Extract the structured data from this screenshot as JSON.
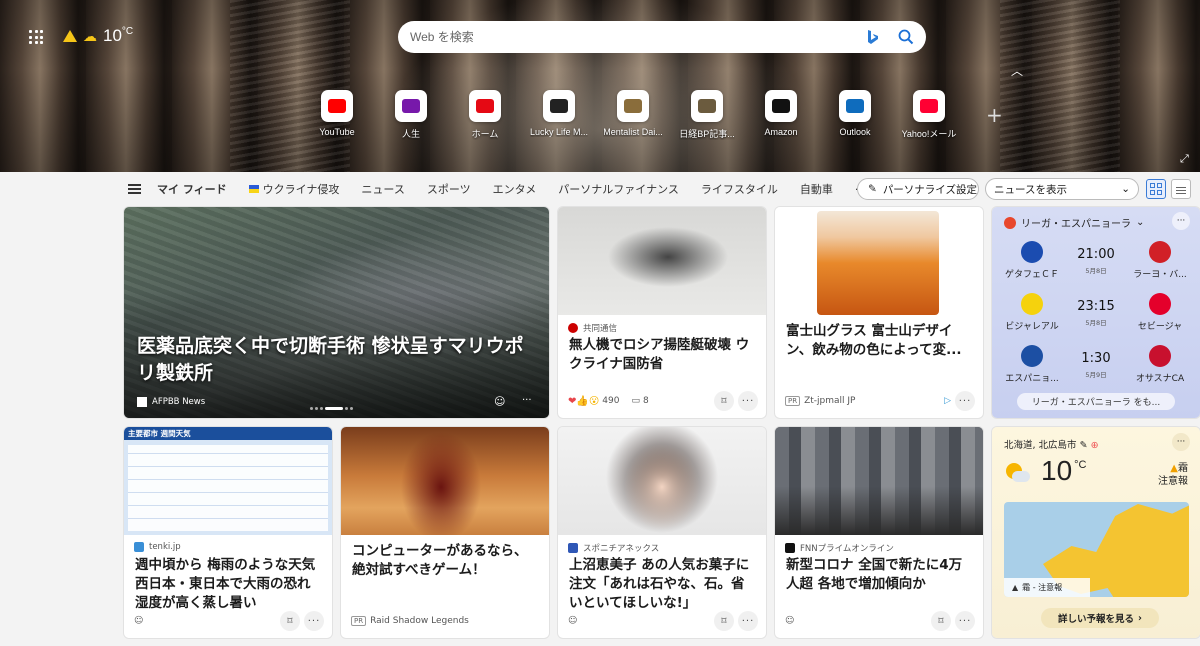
{
  "top": {
    "temperature": "10",
    "temp_unit": "°C"
  },
  "search": {
    "placeholder": "Web を検索"
  },
  "quick_links": [
    {
      "label": "YouTube",
      "icon": "youtube-icon",
      "color": "#ff0000"
    },
    {
      "label": "人生",
      "icon": "onenote-icon",
      "color": "#7719aa"
    },
    {
      "label": "ホーム",
      "icon": "netflix-icon",
      "color": "#e50914"
    },
    {
      "label": "Lucky Life M...",
      "icon": "lucky-life-icon",
      "color": "#222222"
    },
    {
      "label": "Mentalist Dai...",
      "icon": "mentalist-icon",
      "color": "#8a6d3b"
    },
    {
      "label": "日経BP記事...",
      "icon": "nikkei-icon",
      "color": "#6b5b3e"
    },
    {
      "label": "Amazon",
      "icon": "amazon-icon",
      "color": "#111111"
    },
    {
      "label": "Outlook",
      "icon": "outlook-icon",
      "color": "#0f6cbd"
    },
    {
      "label": "Yahoo!メール",
      "icon": "yahoo-mail-icon",
      "color": "#ff0033"
    }
  ],
  "nav": {
    "items": [
      "マイ フィード",
      "ウクライナ侵攻",
      "ニュース",
      "スポーツ",
      "エンタメ",
      "パーソナルファイナンス",
      "ライフスタイル",
      "自動車"
    ],
    "more": "···",
    "personalize": "パーソナライズ設定",
    "view_select": "ニュースを表示"
  },
  "cards": {
    "hero": {
      "title": "医薬品底突く中で切断手術 惨状呈すマリウポリ製鉄所",
      "source": "AFPBB News",
      "more": "···"
    },
    "c2": {
      "source": "共同通信",
      "title": "無人機でロシア揚陸艇破壊 ウクライナ国防省",
      "reactions": "490",
      "comments": "8",
      "more": "···"
    },
    "c3": {
      "pr": "PR",
      "source": "Zt-jpmall JP",
      "title": "富士山グラス 富士山デザイン、飲み物の色によって変...",
      "more": "···"
    },
    "c5": {
      "source": "tenki.jp",
      "title": "週中頃から 梅雨のような天気 西日本・東日本で大雨の恐れ 湿度が高く蒸し暑い",
      "map_title": "主要都市  週間天気",
      "more": "···"
    },
    "c6": {
      "pr": "PR",
      "source": "Raid Shadow Legends",
      "title": "コンピューターがあるなら、絶対試すべきゲーム！"
    },
    "c7": {
      "source": "スポニチアネックス",
      "title": "上沼恵美子 あの人気お菓子に注文「あれは石やな、石。省いといてほしいな!」",
      "more": "···"
    },
    "c8": {
      "source": "FNNプライムオンライン",
      "title": "新型コロナ 全国で新たに4万人超 各地で増加傾向か",
      "more": "···"
    }
  },
  "sports": {
    "league": "リーガ・エスパニョーラ",
    "more": "···",
    "matches": [
      {
        "home": "ゲタフェＣＦ",
        "away": "ラーヨ・バ...",
        "time": "21:00",
        "date": "5月8日",
        "home_color": "#1b4cb0",
        "away_color": "#d12027"
      },
      {
        "home": "ビジャレアル",
        "away": "セビージャ",
        "time": "23:15",
        "date": "5月8日",
        "home_color": "#f5d20d",
        "away_color": "#e4002b"
      },
      {
        "home": "エスパニョ...",
        "away": "オサスナCA",
        "time": "1:30",
        "date": "5月9日",
        "home_color": "#1c4fa3",
        "away_color": "#c8102e"
      }
    ],
    "button": "リーガ・エスパニョーラ をも..."
  },
  "weather": {
    "location": "北海道, 北広島市",
    "temp": "10",
    "unit": "°C",
    "alert_title": "霜",
    "alert_level": "注意報",
    "map_label": "霜 - 注意報",
    "forecast_button": "詳しい予報を見る",
    "more": "···"
  }
}
